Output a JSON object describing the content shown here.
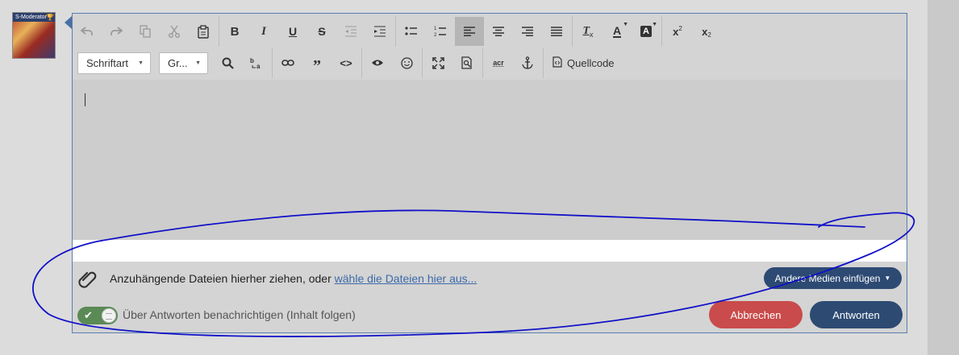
{
  "avatar": {
    "badge": "S-Moderator"
  },
  "toolbar": {
    "font_select": "Schriftart",
    "size_select": "Gr...",
    "source_label": "Quellcode"
  },
  "attach": {
    "text": "Anzuhängende Dateien hierher ziehen, oder ",
    "link": "wähle die Dateien hier aus...",
    "media_button": "Andere Medien einfügen"
  },
  "notify": {
    "label": "Über Antworten benachrichtigen (Inhalt folgen)"
  },
  "buttons": {
    "cancel": "Abbrechen",
    "reply": "Antworten"
  },
  "colors": {
    "toggle_on": "#5a8a55",
    "cancel": "#c94b4b",
    "primary": "#2d4a73",
    "link": "#3c6aa8",
    "annotation": "#1010c8"
  },
  "icons": {
    "row1": [
      "undo-icon",
      "redo-icon",
      "copy-icon",
      "cut-icon",
      "paste-icon",
      "bold-icon",
      "italic-icon",
      "underline-icon",
      "strikethrough-icon",
      "outdent-icon",
      "indent-icon",
      "bulleted-list-icon",
      "numbered-list-icon",
      "align-left-icon",
      "align-center-icon",
      "align-right-icon",
      "justify-icon",
      "remove-format-icon",
      "text-color-icon",
      "background-color-icon",
      "superscript-icon",
      "subscript-icon"
    ],
    "row2": [
      "search-icon",
      "replace-icon",
      "link-icon",
      "quote-icon",
      "code-icon",
      "preview-icon",
      "smiley-icon",
      "maximize-icon",
      "preview-page-icon",
      "abbreviation-icon",
      "anchor-icon",
      "source-icon"
    ]
  }
}
